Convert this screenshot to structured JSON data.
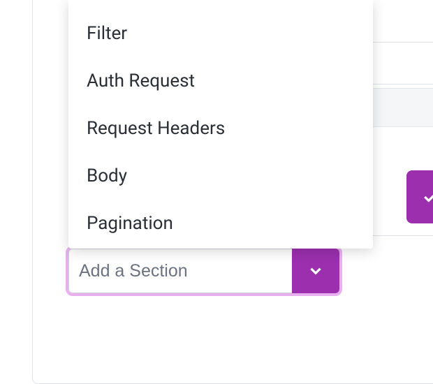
{
  "colors": {
    "accent": "#9b2fae"
  },
  "combo": {
    "placeholder": "Add a Section",
    "value": ""
  },
  "dropdown": {
    "items": [
      {
        "label": "Filter"
      },
      {
        "label": "Auth Request"
      },
      {
        "label": "Request Headers"
      },
      {
        "label": "Body"
      },
      {
        "label": "Pagination"
      }
    ]
  }
}
